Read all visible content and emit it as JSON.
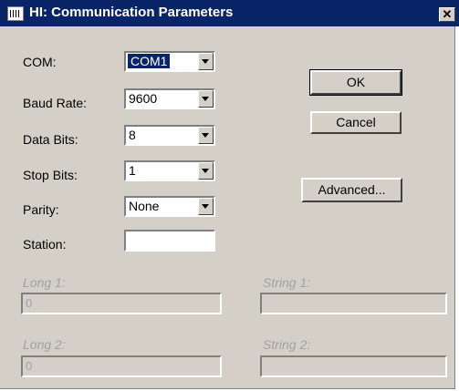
{
  "window": {
    "title": "HI: Communication Parameters",
    "close_glyph": "✕"
  },
  "fields": {
    "com": {
      "label": "COM:",
      "value": "COM1"
    },
    "baud_rate": {
      "label": "Baud Rate:",
      "value": "9600"
    },
    "data_bits": {
      "label": "Data Bits:",
      "value": "8"
    },
    "stop_bits": {
      "label": "Stop Bits:",
      "value": "1"
    },
    "parity": {
      "label": "Parity:",
      "value": "None"
    },
    "station": {
      "label": "Station:",
      "value": ""
    }
  },
  "buttons": {
    "ok": "OK",
    "cancel": "Cancel",
    "advanced": "Advanced..."
  },
  "disabled": {
    "long1": {
      "label": "Long 1:",
      "value": "0"
    },
    "long2": {
      "label": "Long 2:",
      "value": "0"
    },
    "string1": {
      "label": "String 1:",
      "value": ""
    },
    "string2": {
      "label": "String 2:",
      "value": ""
    }
  }
}
